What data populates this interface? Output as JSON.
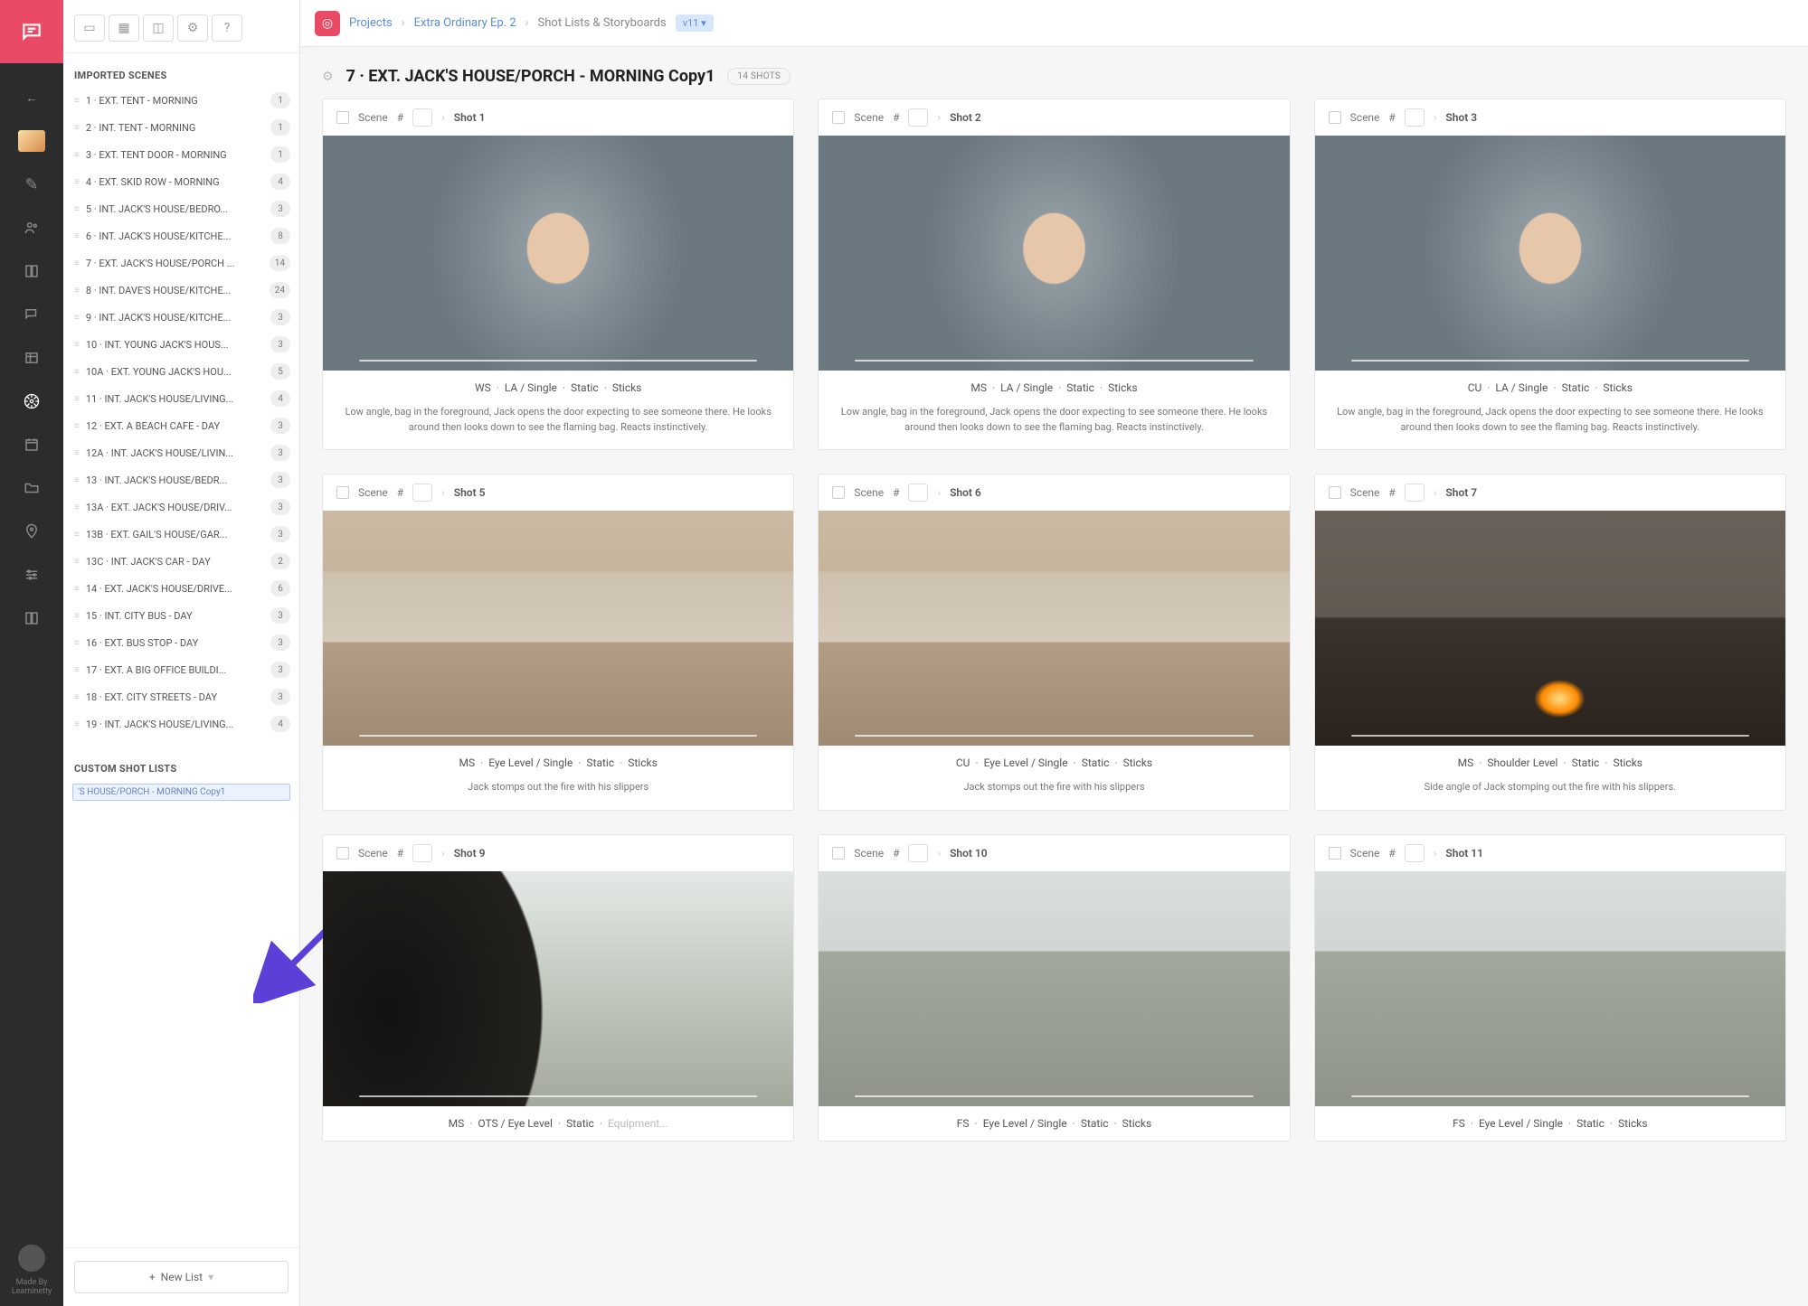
{
  "breadcrumb": {
    "projects": "Projects",
    "project": "Extra Ordinary Ep. 2",
    "page": "Shot Lists & Storyboards",
    "version": "v11"
  },
  "sidebar": {
    "heading_scenes": "IMPORTED SCENES",
    "heading_custom": "CUSTOM SHOT LISTS",
    "scenes": [
      {
        "label": "1 · EXT. TENT - MORNING",
        "count": "1"
      },
      {
        "label": "2 · INT. TENT - MORNING",
        "count": "1"
      },
      {
        "label": "3 · EXT. TENT DOOR - MORNING",
        "count": "1"
      },
      {
        "label": "4 · EXT. SKID ROW - MORNING",
        "count": "4"
      },
      {
        "label": "5 · INT. JACK'S HOUSE/BEDRO...",
        "count": "3"
      },
      {
        "label": "6 · INT. JACK'S HOUSE/KITCHE...",
        "count": "8"
      },
      {
        "label": "7 · EXT. JACK'S HOUSE/PORCH ...",
        "count": "14"
      },
      {
        "label": "8 · INT. DAVE'S HOUSE/KITCHE...",
        "count": "24"
      },
      {
        "label": "9 · INT. JACK'S HOUSE/KITCHE...",
        "count": "3"
      },
      {
        "label": "10 · INT. YOUNG JACK'S HOUS...",
        "count": "3"
      },
      {
        "label": "10A · EXT. YOUNG JACK'S HOU...",
        "count": "5"
      },
      {
        "label": "11 · INT. JACK'S HOUSE/LIVING...",
        "count": "4"
      },
      {
        "label": "12 · EXT. A BEACH CAFE - DAY",
        "count": "3"
      },
      {
        "label": "12A · INT. JACK'S HOUSE/LIVIN...",
        "count": "3"
      },
      {
        "label": "13 · INT. JACK'S HOUSE/BEDR...",
        "count": "3"
      },
      {
        "label": "13A · EXT. JACK'S HOUSE/DRIV...",
        "count": "3"
      },
      {
        "label": "13B · EXT. GAIL'S HOUSE/GAR...",
        "count": "3"
      },
      {
        "label": "13C · INT. JACK'S CAR - DAY",
        "count": "2"
      },
      {
        "label": "14 · EXT. JACK'S HOUSE/DRIVE...",
        "count": "6"
      },
      {
        "label": "15 · INT. CITY BUS - DAY",
        "count": "3"
      },
      {
        "label": "16 · EXT. BUS STOP - DAY",
        "count": "3"
      },
      {
        "label": "17 · EXT. A BIG OFFICE BUILDI...",
        "count": "3"
      },
      {
        "label": "18 · EXT. CITY STREETS - DAY",
        "count": "3"
      },
      {
        "label": "19 · INT. JACK'S HOUSE/LIVING...",
        "count": "4"
      }
    ],
    "custom_input": "'S HOUSE/PORCH - MORNING Copy1",
    "new_list": "New List"
  },
  "header": {
    "title": "7 · EXT. JACK'S HOUSE/PORCH - MORNING Copy1",
    "shot_count": "14 SHOTS",
    "scene_label": "Scene",
    "hash": "#"
  },
  "shots": [
    {
      "name": "Shot 1",
      "specs": [
        "WS",
        "LA / Single",
        "Static",
        "Sticks"
      ],
      "caption": "Low angle, bag in the foreground, Jack opens the door expecting to see someone there. He looks around then looks down to see the flaming bag. Reacts instinctively.",
      "bg": "bg-man"
    },
    {
      "name": "Shot 2",
      "specs": [
        "MS",
        "LA / Single",
        "Static",
        "Sticks"
      ],
      "caption": "Low angle, bag in the foreground, Jack opens the door expecting to see someone there. He looks around then looks down to see the flaming bag. Reacts instinctively.",
      "bg": "bg-man"
    },
    {
      "name": "Shot 3",
      "specs": [
        "CU",
        "LA / Single",
        "Static",
        "Sticks"
      ],
      "caption": "Low angle, bag in the foreground, Jack opens the door expecting to see someone there. He looks around then looks down to see the flaming bag. Reacts instinctively.",
      "bg": "bg-man"
    },
    {
      "name": "Shot 5",
      "specs": [
        "MS",
        "Eye Level / Single",
        "Static",
        "Sticks"
      ],
      "caption": "Jack stomps out the fire with his slippers",
      "bg": "bg-porch"
    },
    {
      "name": "Shot 6",
      "specs": [
        "CU",
        "Eye Level / Single",
        "Static",
        "Sticks"
      ],
      "caption": "Jack stomps out the fire with his slippers",
      "bg": "bg-porch"
    },
    {
      "name": "Shot 7",
      "specs": [
        "MS",
        "Shoulder Level",
        "Static",
        "Sticks"
      ],
      "caption": "Side angle of Jack stomping out the fire with his slippers.",
      "bg": "bg-porch-fire"
    },
    {
      "name": "Shot 9",
      "specs": [
        "MS",
        "OTS / Eye Level",
        "Static"
      ],
      "caption": "",
      "equip": "Equipment...",
      "bg": "bg-ots"
    },
    {
      "name": "Shot 10",
      "specs": [
        "FS",
        "Eye Level / Single",
        "Static",
        "Sticks"
      ],
      "caption": "",
      "bg": "bg-street"
    },
    {
      "name": "Shot 11",
      "specs": [
        "FS",
        "Eye Level / Single",
        "Static",
        "Sticks"
      ],
      "caption": "",
      "bg": "bg-street"
    }
  ],
  "rail_made": "Made By\nLearninetty"
}
